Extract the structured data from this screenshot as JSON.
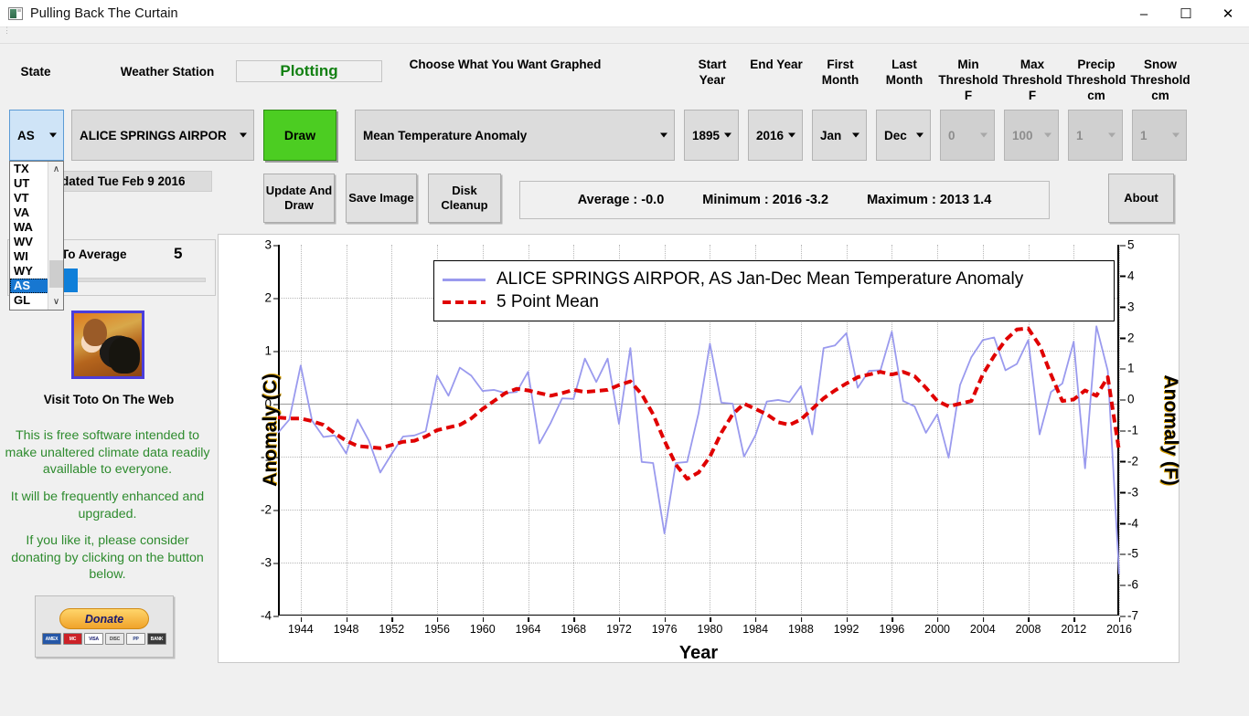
{
  "window": {
    "title": "Pulling Back The Curtain",
    "icon": "app-window-icon",
    "minimize": "–",
    "maximize": "☐",
    "close": "✕"
  },
  "labels": {
    "state": "State",
    "weather_station": "Weather Station",
    "choose_graph": "Choose What You Want Graphed",
    "start_year": "Start Year",
    "end_year": "End Year",
    "first_month": "First Month",
    "last_month": "Last Month",
    "min_threshold": "Min Threshold F",
    "max_threshold": "Max Threshold F",
    "precip_threshold": "Precip Threshold cm",
    "snow_threshold": "Snow Threshold cm"
  },
  "controls": {
    "state_value": "AS",
    "station_value": "ALICE SPRINGS AIRPOR",
    "graph_value": "Mean Temperature Anomaly",
    "start_year_value": "1895",
    "end_year_value": "2016",
    "first_month_value": "Jan",
    "last_month_value": "Dec",
    "min_threshold_value": "0",
    "max_threshold_value": "100",
    "precip_threshold_value": "1",
    "snow_threshold_value": "1"
  },
  "state_dropdown": {
    "items": [
      "TX",
      "UT",
      "VT",
      "VA",
      "WA",
      "WV",
      "WI",
      "WY",
      "AS",
      "GL"
    ],
    "selected": "AS",
    "scroll_up": "∧",
    "scroll_down": "∨"
  },
  "status": {
    "plotting": "Plotting",
    "last_updated": "Last updated Tue Feb 9 2016"
  },
  "buttons": {
    "draw": "Draw",
    "update_and_draw": "Update And Draw",
    "save_image": "Save Image",
    "disk_cleanup": "Disk Cleanup",
    "about": "About"
  },
  "stats": {
    "average": "Average : -0.0",
    "minimum": "Minimum : 2016  -3.2",
    "maximum": "Maximum : 2013  1.4"
  },
  "average_slider": {
    "label": "Points To Average",
    "value": "5"
  },
  "sidebar": {
    "toto_caption": "Visit Toto On The Web",
    "blurb1": "This is free software intended to make unaltered climate data readily availlable to everyone.",
    "blurb2": "It will be frequently enhanced and upgraded.",
    "blurb3": "If you like it, please consider donating by clicking on the button below.",
    "donate_label": "Donate",
    "cards": [
      "AMEX",
      "MC",
      "VISA",
      "DISC",
      "PP",
      "BANK"
    ]
  },
  "colors": {
    "series_line": "#9a9aee",
    "mean_line": "#e00000",
    "draw_button": "#4ccd22",
    "plotting_text": "#128012",
    "blurb_text": "#2e8b2e",
    "selected_item": "#1777d1"
  },
  "chart_data": {
    "type": "line",
    "title": "",
    "xlabel": "Year",
    "ylabel": "Anomaly (C)",
    "ylabel_right": "Anomaly (F)",
    "xlim": [
      1942,
      2016
    ],
    "ylim": [
      -4,
      3
    ],
    "ylim_right": [
      -7,
      5
    ],
    "yticks": [
      3,
      2,
      1,
      0,
      -1,
      -2,
      -3,
      -4
    ],
    "yticks_right": [
      5,
      4,
      3,
      2,
      1,
      0,
      -1,
      -2,
      -3,
      -4,
      -5,
      -6,
      -7
    ],
    "xticks": [
      1944,
      1948,
      1952,
      1956,
      1960,
      1964,
      1968,
      1972,
      1976,
      1980,
      1984,
      1988,
      1992,
      1996,
      2000,
      2004,
      2008,
      2012,
      2016
    ],
    "grid": true,
    "legend_position": "top-center",
    "legend": [
      "ALICE SPRINGS AIRPOR, AS  Jan-Dec  Mean Temperature Anomaly",
      "5 Point Mean"
    ],
    "series": [
      {
        "name": "ALICE SPRINGS AIRPOR, AS  Jan-Dec  Mean Temperature Anomaly",
        "color": "#9a9aee",
        "style": "solid",
        "x": [
          1942,
          1943,
          1944,
          1945,
          1946,
          1947,
          1948,
          1949,
          1950,
          1951,
          1952,
          1953,
          1954,
          1955,
          1956,
          1957,
          1958,
          1959,
          1960,
          1961,
          1962,
          1963,
          1964,
          1965,
          1966,
          1967,
          1968,
          1969,
          1970,
          1971,
          1972,
          1973,
          1974,
          1975,
          1976,
          1977,
          1978,
          1979,
          1980,
          1981,
          1982,
          1983,
          1984,
          1985,
          1986,
          1987,
          1988,
          1989,
          1990,
          1991,
          1992,
          1993,
          1994,
          1995,
          1996,
          1997,
          1998,
          1999,
          2000,
          2001,
          2002,
          2003,
          2004,
          2005,
          2006,
          2007,
          2008,
          2009,
          2010,
          2011,
          2012,
          2013,
          2014,
          2015,
          2016
        ],
        "y": [
          -0.55,
          -0.3,
          0.72,
          -0.32,
          -0.63,
          -0.6,
          -0.94,
          -0.3,
          -0.7,
          -1.3,
          -0.95,
          -0.62,
          -0.6,
          -0.52,
          0.53,
          0.15,
          0.68,
          0.53,
          0.24,
          0.26,
          0.2,
          0.22,
          0.6,
          -0.75,
          -0.36,
          0.1,
          0.09,
          0.85,
          0.41,
          0.85,
          -0.38,
          1.05,
          -1.1,
          -1.12,
          -2.45,
          -1.12,
          -1.1,
          -0.18,
          1.13,
          0.02,
          0.0,
          -1.0,
          -0.6,
          0.04,
          0.07,
          0.03,
          0.33,
          -0.58,
          1.05,
          1.1,
          1.33,
          0.3,
          0.62,
          0.63,
          1.36,
          0.05,
          -0.05,
          -0.55,
          -0.2,
          -1.02,
          0.35,
          0.88,
          1.2,
          1.25,
          0.63,
          0.75,
          1.2,
          -0.58,
          0.22,
          0.38,
          1.17,
          -1.22,
          1.46,
          0.62,
          -3.22
        ]
      },
      {
        "name": "5 Point Mean",
        "color": "#e00000",
        "style": "dashed",
        "x": [
          1942,
          1943,
          1944,
          1945,
          1946,
          1947,
          1948,
          1949,
          1950,
          1951,
          1952,
          1953,
          1954,
          1955,
          1956,
          1957,
          1958,
          1959,
          1960,
          1961,
          1962,
          1963,
          1964,
          1965,
          1966,
          1967,
          1968,
          1969,
          1970,
          1971,
          1972,
          1973,
          1974,
          1975,
          1976,
          1977,
          1978,
          1979,
          1980,
          1981,
          1982,
          1983,
          1984,
          1985,
          1986,
          1987,
          1988,
          1989,
          1990,
          1991,
          1992,
          1993,
          1994,
          1995,
          1996,
          1997,
          1998,
          1999,
          2000,
          2001,
          2002,
          2003,
          2004,
          2005,
          2006,
          2007,
          2008,
          2009,
          2010,
          2011,
          2012,
          2013,
          2014,
          2015,
          2016
        ],
        "y": [
          -0.26,
          -0.28,
          -0.28,
          -0.33,
          -0.4,
          -0.56,
          -0.7,
          -0.8,
          -0.82,
          -0.84,
          -0.78,
          -0.72,
          -0.7,
          -0.62,
          -0.5,
          -0.45,
          -0.4,
          -0.28,
          -0.1,
          0.05,
          0.2,
          0.28,
          0.25,
          0.2,
          0.15,
          0.2,
          0.26,
          0.22,
          0.24,
          0.26,
          0.35,
          0.42,
          0.18,
          -0.2,
          -0.7,
          -1.15,
          -1.42,
          -1.3,
          -1.0,
          -0.55,
          -0.2,
          0.0,
          -0.1,
          -0.2,
          -0.35,
          -0.4,
          -0.3,
          -0.1,
          0.1,
          0.25,
          0.38,
          0.5,
          0.55,
          0.6,
          0.55,
          0.6,
          0.52,
          0.3,
          0.05,
          -0.05,
          0.0,
          0.05,
          0.55,
          0.9,
          1.2,
          1.4,
          1.42,
          1.1,
          0.55,
          0.05,
          0.08,
          0.25,
          0.15,
          0.5,
          -0.9
        ]
      }
    ]
  }
}
